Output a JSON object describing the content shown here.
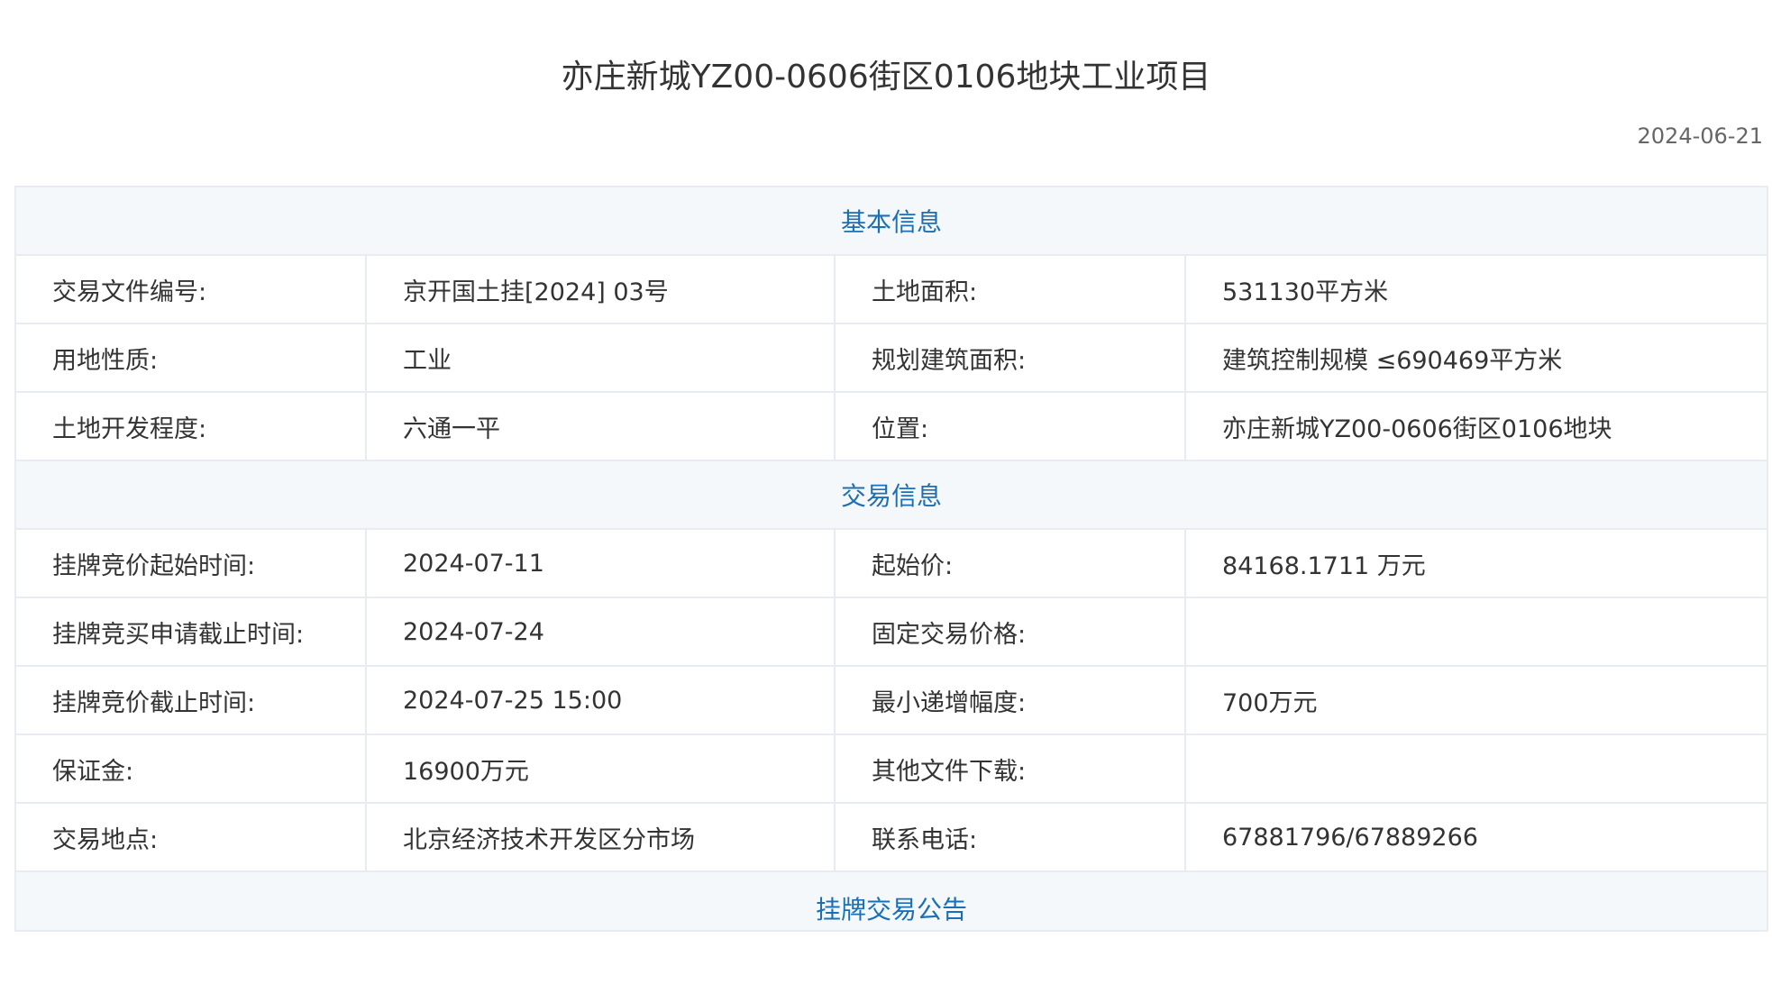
{
  "page": {
    "title": "亦庄新城YZ00-0606街区0106地块工业项目",
    "date": "2024-06-21"
  },
  "sections": {
    "basic": {
      "title": "基本信息",
      "rows": [
        {
          "l1": "交易文件编号:",
          "v1": "京开国土挂[2024] 03号",
          "l2": "土地面积:",
          "v2": "531130平方米"
        },
        {
          "l1": "用地性质:",
          "v1": "工业",
          "l2": "规划建筑面积:",
          "v2": "建筑控制规模 ≤690469平方米"
        },
        {
          "l1": "土地开发程度:",
          "v1": "六通一平",
          "l2": "位置:",
          "v2": "亦庄新城YZ00-0606街区0106地块"
        }
      ]
    },
    "trade": {
      "title": "交易信息",
      "rows": [
        {
          "l1": "挂牌竞价起始时间:",
          "v1": "2024-07-11",
          "l2": "起始价:",
          "v2": "84168.1711 万元"
        },
        {
          "l1": "挂牌竞买申请截止时间:",
          "v1": "2024-07-24",
          "l2": "固定交易价格:",
          "v2": ""
        },
        {
          "l1": "挂牌竞价截止时间:",
          "v1": "2024-07-25 15:00",
          "l2": "最小递增幅度:",
          "v2": "700万元"
        },
        {
          "l1": "保证金:",
          "v1": "16900万元",
          "l2": "其他文件下载:",
          "v2": ""
        },
        {
          "l1": "交易地点:",
          "v1": "北京经济技术开发区分市场",
          "l2": "联系电话:",
          "v2": "67881796/67889266"
        }
      ]
    },
    "announcement": {
      "title": "挂牌交易公告"
    }
  },
  "colors": {
    "accent": "#1b6fb5",
    "section_bg": "#f4f8fb",
    "border": "#e6ecf2"
  }
}
